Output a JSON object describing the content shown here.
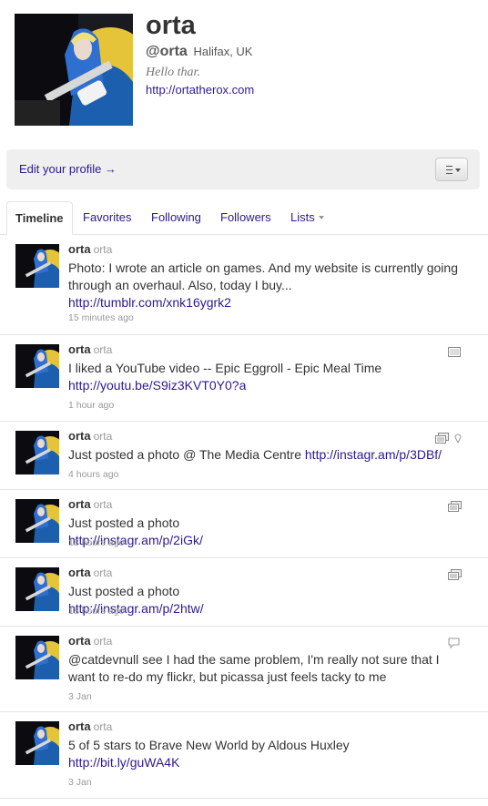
{
  "profile": {
    "name": "orta",
    "handle": "@orta",
    "location": "Halifax, UK",
    "bio": "Hello thar.",
    "url": "http://ortatherox.com"
  },
  "editbar": {
    "edit_label": "Edit your profile →"
  },
  "tabs": [
    {
      "label": "Timeline"
    },
    {
      "label": "Favorites"
    },
    {
      "label": "Following"
    },
    {
      "label": "Followers"
    },
    {
      "label": "Lists"
    }
  ],
  "tweets": [
    {
      "name": "orta",
      "screen_name": "orta",
      "text": "Photo: I wrote an article on games. And my website is currently going through an overhaul. Also, today I buy...",
      "link": "http://tumblr.com/xnk16ygrk2",
      "time": "15 minutes ago",
      "icons": []
    },
    {
      "name": "orta",
      "screen_name": "orta",
      "text": "I liked a YouTube video -- Epic Eggroll - Epic Meal Time",
      "link": "http://youtu.be/S9iz3KVT0Y0?a",
      "time": "1 hour ago",
      "icons": [
        "video-icon"
      ]
    },
    {
      "name": "orta",
      "screen_name": "orta",
      "text": "Just posted a photo @ The Media Centre",
      "link": "http://instagr.am/p/3DBf/",
      "time": "4 hours ago",
      "icons": [
        "photo-icon",
        "location-pin-icon"
      ]
    },
    {
      "name": "orta",
      "screen_name": "orta",
      "text": "Just posted a photo",
      "link": "http://instagr.am/p/2iGk/",
      "time": "18 hours ago",
      "icons": [
        "photo-icon"
      ]
    },
    {
      "name": "orta",
      "screen_name": "orta",
      "text": "Just posted a photo",
      "link": "http://instagr.am/p/2htw/",
      "time": "18 hours ago",
      "icons": [
        "photo-icon"
      ]
    },
    {
      "name": "orta",
      "screen_name": "orta",
      "text": "@catdevnull see I had the same problem, I'm really not sure that I want to re-do my flickr, but picassa just feels tacky to me",
      "link": "",
      "time": "3 Jan",
      "icons": [
        "reply-bubble-icon"
      ]
    },
    {
      "name": "orta",
      "screen_name": "orta",
      "text": "5 of 5 stars to Brave New World by Aldous Huxley",
      "link": "http://bit.ly/guWA4K",
      "time": "3 Jan",
      "icons": []
    }
  ],
  "colors": {
    "link": "#2a1b8c",
    "text": "#333333",
    "muted": "#999999",
    "bar_bg": "#efefef"
  }
}
